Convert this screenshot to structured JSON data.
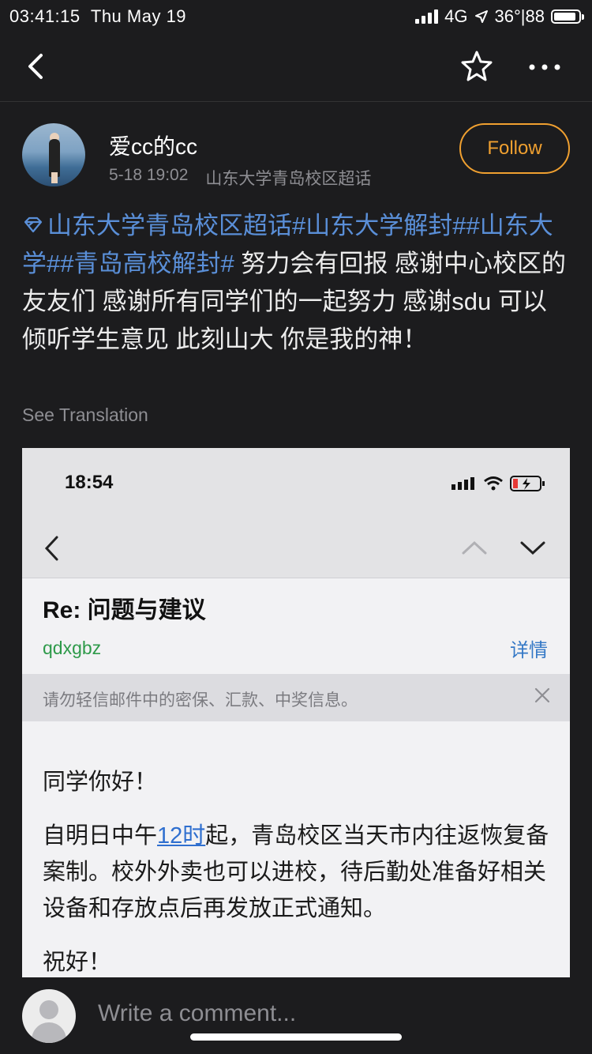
{
  "status_bar": {
    "time": "03:41:15",
    "date": "Thu May 19",
    "network": "4G",
    "temp_signal": "36°|88"
  },
  "nav": {
    "back_icon": "chevron-left-icon",
    "favorite_icon": "star-icon",
    "more_icon": "more-icon"
  },
  "post": {
    "author": "爱cc的cc",
    "timestamp": "5-18 19:02",
    "topic": "山东大学青岛校区超话",
    "follow_label": "Follow",
    "tag1": "山东大学青岛校区超话",
    "tag2": "#山东大学解封#",
    "tag3": "#山东大学#",
    "tag4": "#青岛高校解封#",
    "text": " 努力会有回报  感谢中心校区的友友们  感谢所有同学们的一起努力  感谢sdu  可以倾听学生意见  此刻山大  你是我的神！",
    "see_translation": "See Translation"
  },
  "embedded_email": {
    "status_time": "18:54",
    "subject": "Re: 问题与建议",
    "sender": "qdxgbz",
    "details_label": "详情",
    "warning": "请勿轻信邮件中的密保、汇款、中奖信息。",
    "greeting": "同学你好！",
    "body_before_link": "自明日中午",
    "body_link": "12时",
    "body_after_link": "起，青岛校区当天市内往返恢复备案制。校外外卖也可以进校，待后勤处准备好相关设备和存放点后再发放正式通知。",
    "closing": "祝好！"
  },
  "comment_bar": {
    "placeholder": "Write a comment..."
  },
  "colors": {
    "accent_orange": "#f0a030",
    "tag_blue": "#5a8fd8",
    "background": "#1c1c1e"
  }
}
